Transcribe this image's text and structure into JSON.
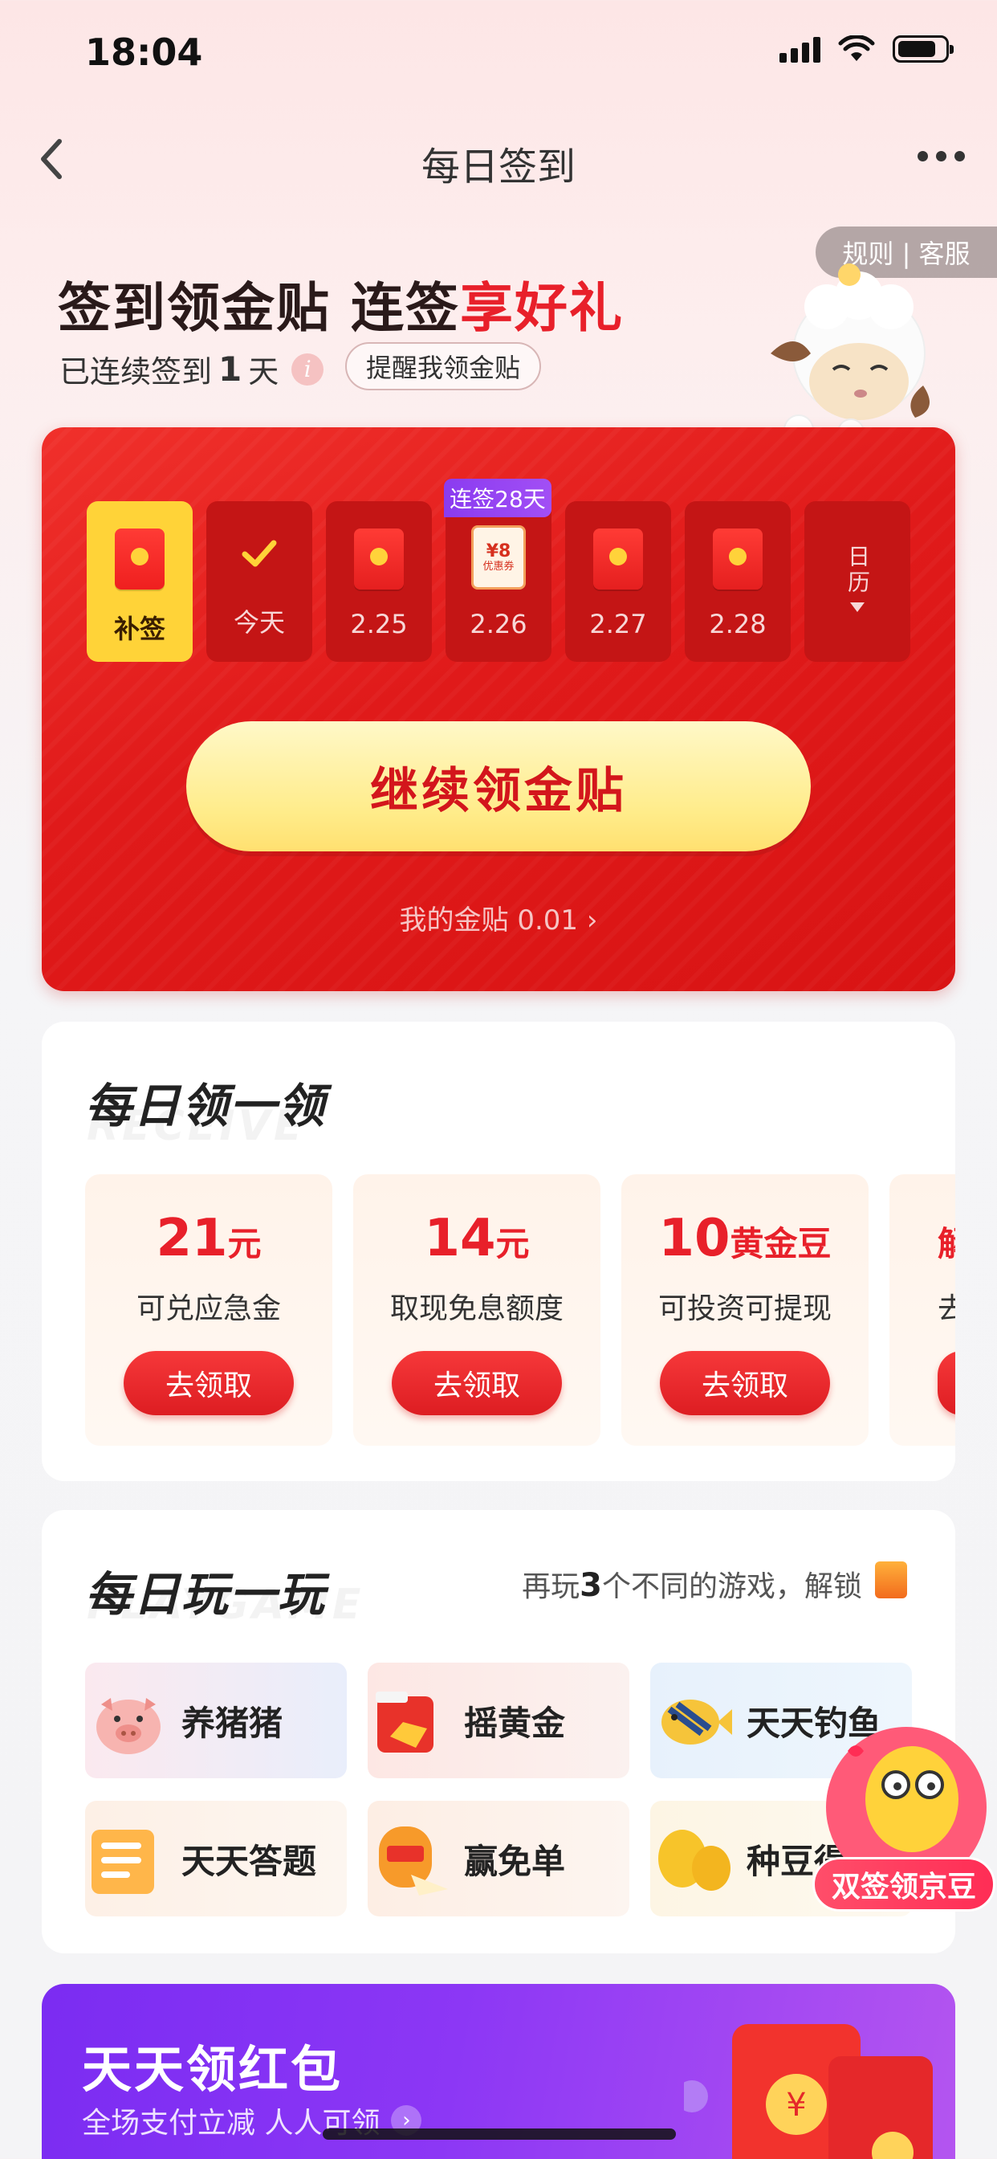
{
  "status_bar": {
    "time": "18:04"
  },
  "nav": {
    "title": "每日签到"
  },
  "header": {
    "rule_link": "规则 | 客服",
    "headline_part1": "签到领金贴 连签",
    "headline_part2": "享好礼",
    "streak_prefix": "已连续签到",
    "streak_days": "1",
    "streak_suffix": "天",
    "remind_button": "提醒我领金贴"
  },
  "signin": {
    "days": [
      {
        "label": "补签",
        "state": "makeup"
      },
      {
        "label": "今天",
        "state": "checked"
      },
      {
        "label": "2.25",
        "state": "envelope"
      },
      {
        "label": "2.26",
        "state": "coupon"
      },
      {
        "label": "2.27",
        "state": "envelope"
      },
      {
        "label": "2.28",
        "state": "envelope"
      },
      {
        "label": "日历",
        "state": "calendar"
      }
    ],
    "streak_tag": "连签28天",
    "coupon_value": "¥8",
    "coupon_text": "优惠券",
    "cta_label": "继续领金贴",
    "my_coins": "我的金贴 0.01"
  },
  "daily_claim": {
    "title": "每日领一领",
    "ghost": "RECEIVE",
    "rewards": [
      {
        "amount": "21",
        "unit": "元",
        "desc": "可兑应急金",
        "button": "去领取"
      },
      {
        "amount": "14",
        "unit": "元",
        "desc": "取现免息额度",
        "button": "去领取"
      },
      {
        "amount": "10",
        "unit": "黄金豆",
        "desc": "可投资可提现",
        "button": "去领取"
      },
      {
        "amount": "",
        "unit": "解",
        "desc": "去",
        "button": ""
      }
    ]
  },
  "daily_play": {
    "title": "每日玩一玩",
    "ghost": "PLAYGAME",
    "hint_prefix": "再玩",
    "hint_count": "3",
    "hint_suffix": "个不同的游戏，解锁",
    "games": [
      {
        "name": "养猪猪",
        "icon": "pig-icon"
      },
      {
        "name": "摇黄金",
        "icon": "gold-icon"
      },
      {
        "name": "天天钓鱼",
        "icon": "fish-icon"
      },
      {
        "name": "天天答题",
        "icon": "quiz-icon"
      },
      {
        "name": "赢免单",
        "icon": "free-order-icon"
      },
      {
        "name": "种豆得",
        "icon": "bean-icon"
      }
    ],
    "float_badge": "双签领京豆"
  },
  "banner": {
    "title": "天天领红包",
    "subtitle": "全场支付立减 人人可领"
  },
  "colors": {
    "accent": "#e8202a",
    "cta": "#ffec8a",
    "banner": "#8c37f5"
  }
}
